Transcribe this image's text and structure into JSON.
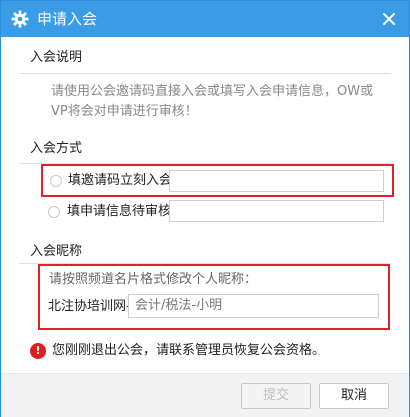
{
  "titlebar": {
    "title": "申请入会",
    "icon": "gear-icon",
    "close_icon": "close-icon"
  },
  "intro": {
    "label": "入会说明",
    "text": "请使用公会邀请码直接入会或填写入会申请信息，OW或VP将会对申请进行审核！"
  },
  "method": {
    "label": "入会方式",
    "options": [
      {
        "label": "填邀请码立刻入会",
        "input_value": ""
      },
      {
        "label": "填申请信息待审核",
        "input_value": ""
      }
    ]
  },
  "nickname": {
    "label": "入会昵称",
    "tip": "请按照频道名片格式修改个人昵称：",
    "prefix": "北注协培训网-",
    "value": "会计/税法-小明"
  },
  "warning": {
    "icon": "!",
    "text": "您刚刚退出公会，请联系管理员恢复公会资格。"
  },
  "footer": {
    "submit_label": "提交",
    "cancel_label": "取消"
  },
  "colors": {
    "titlebar": "#3a9be6",
    "highlight": "#e0202a",
    "warning": "#e02020"
  }
}
